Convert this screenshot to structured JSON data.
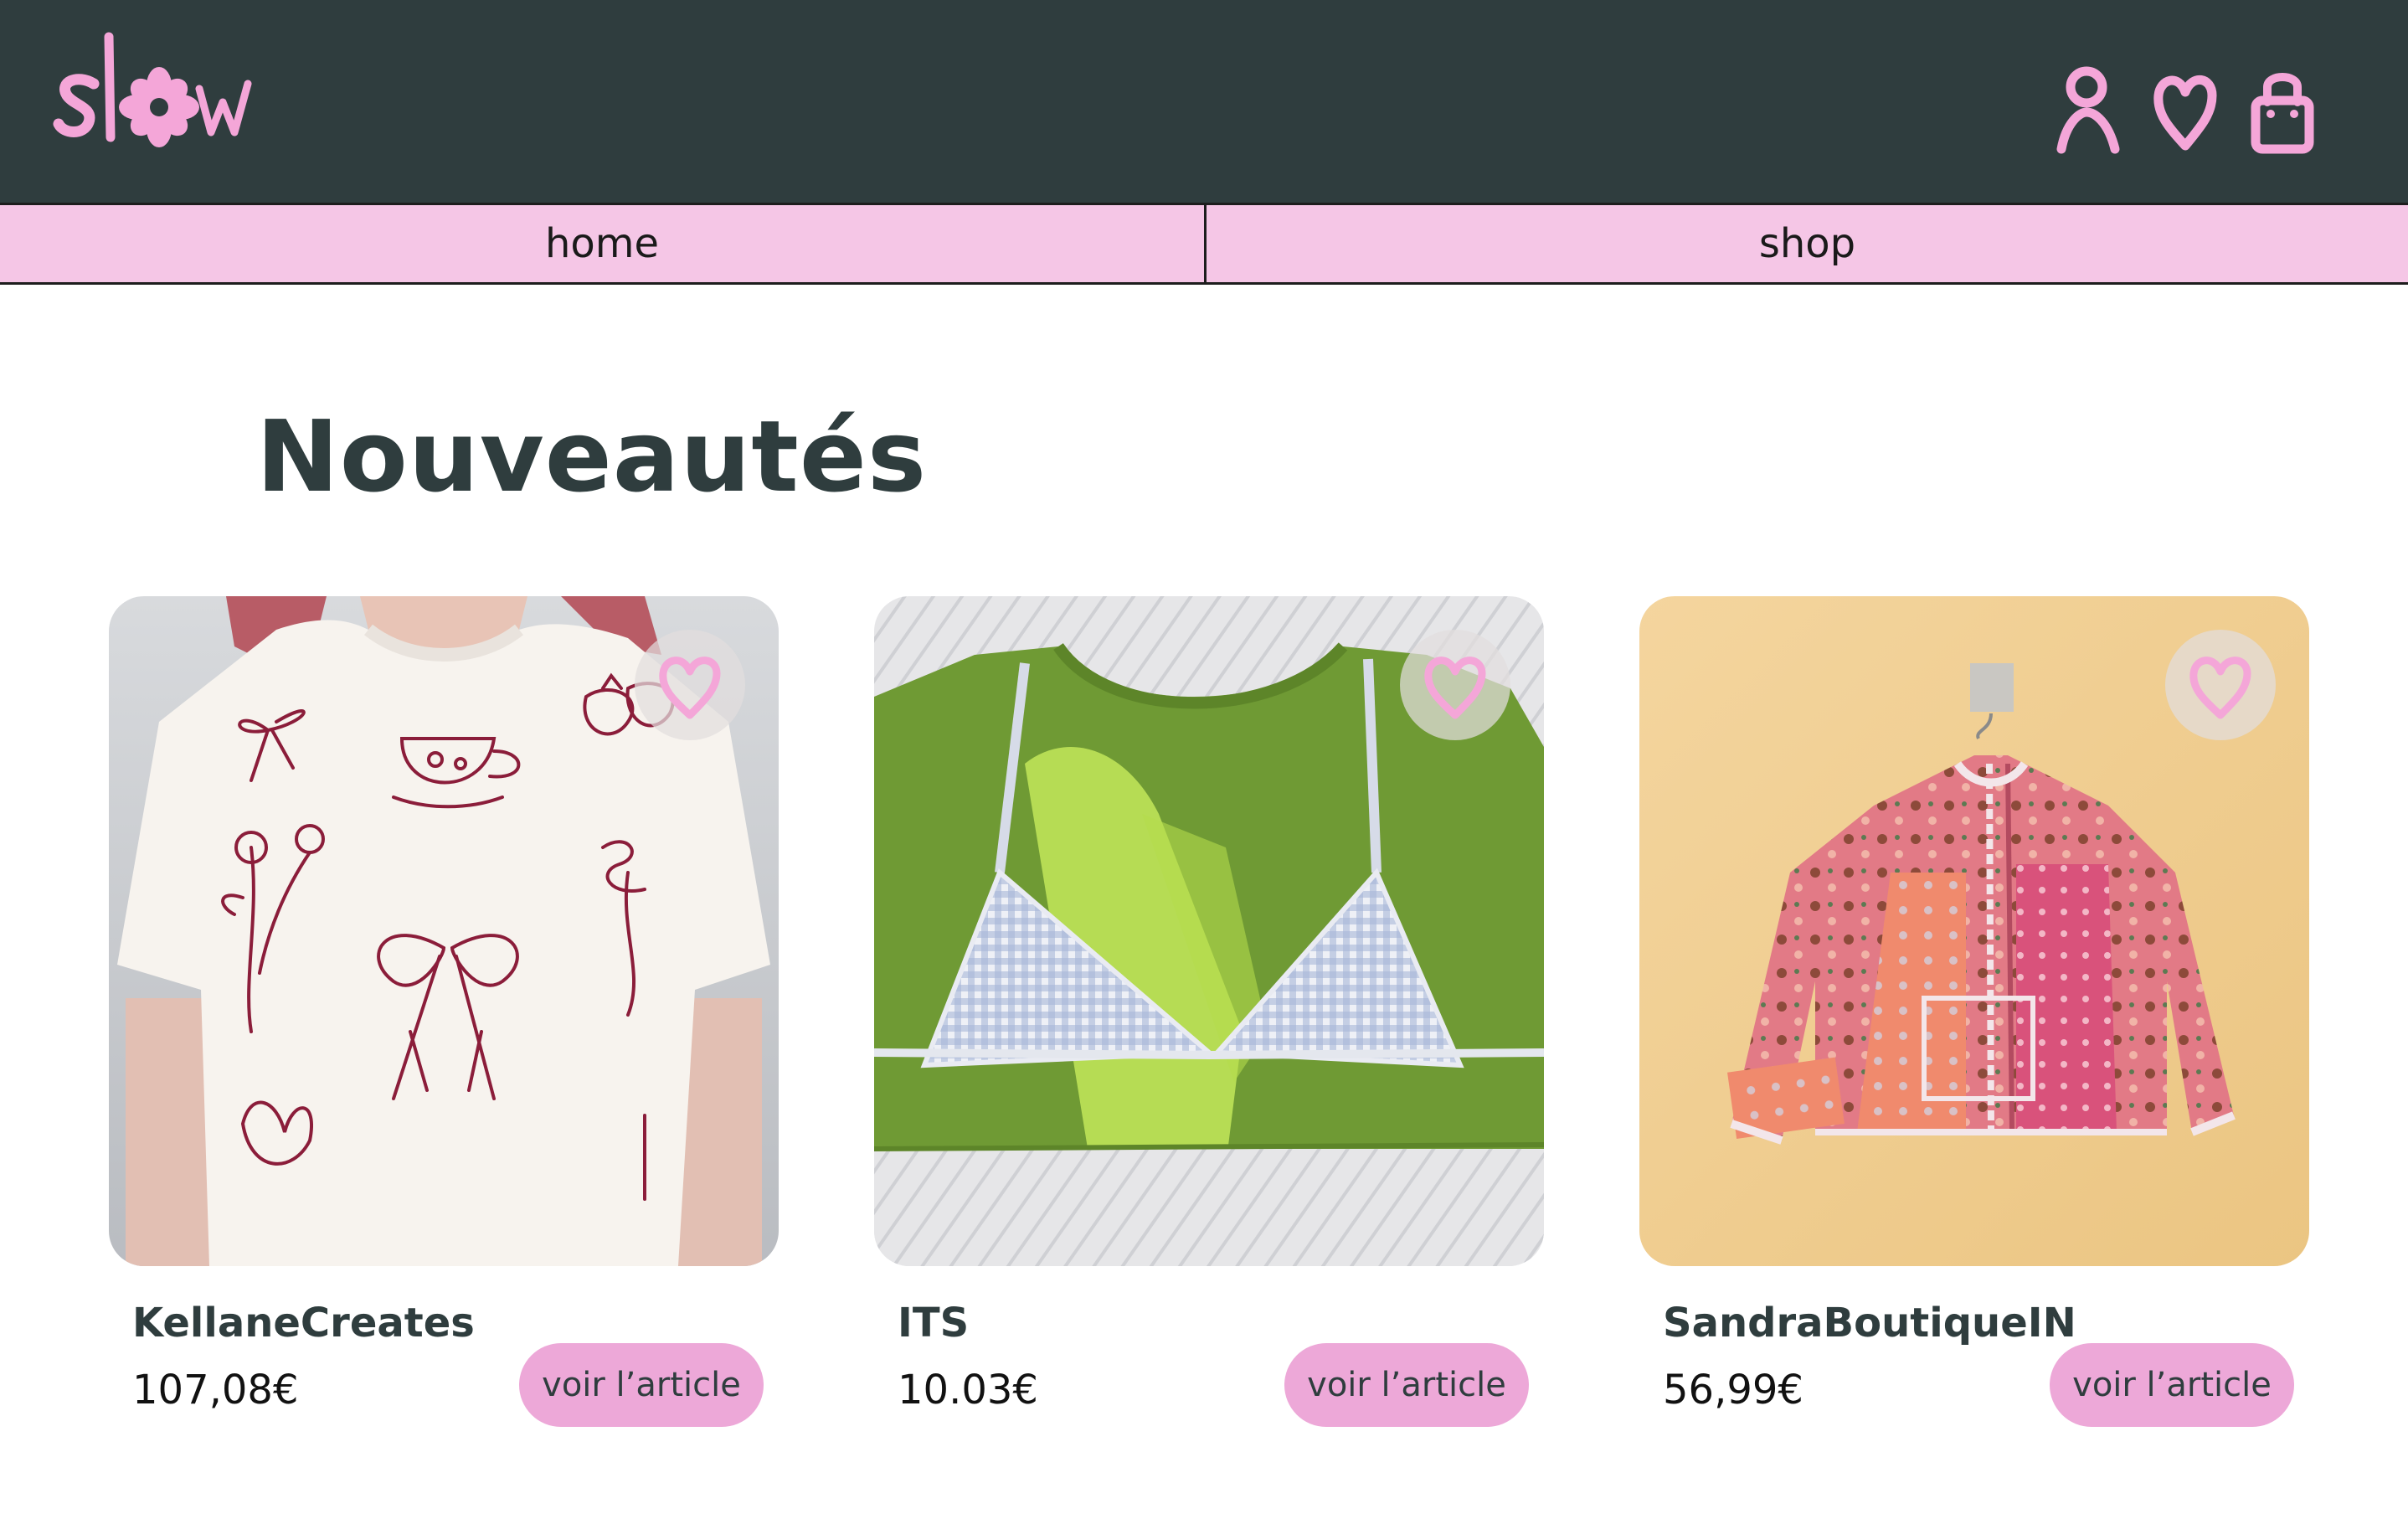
{
  "brand": {
    "logo_text": "slow",
    "accent_color": "#f4a6d8",
    "dark_color": "#2f3d3e"
  },
  "header": {
    "icons": [
      "user-icon",
      "heart-icon",
      "shopping-bag-icon"
    ]
  },
  "nav": {
    "items": [
      {
        "label": "home"
      },
      {
        "label": "shop"
      }
    ]
  },
  "section": {
    "title": "Nouveautés"
  },
  "products": [
    {
      "seller": "KellaneCreates",
      "price": "107,08€",
      "button": "voir l’article",
      "image": "white t-shirt with embroidered bows, teacup, flowers and strawberries"
    },
    {
      "seller": "ITS",
      "price": "10.03€",
      "button": "voir l’article",
      "image": "green t-shirt with gingham bralette sewn on"
    },
    {
      "seller": "SandraBoutiqueIN",
      "price": "56,99€",
      "button": "voir l’article",
      "image": "pink patchwork quilted jacket on a hanger"
    }
  ]
}
